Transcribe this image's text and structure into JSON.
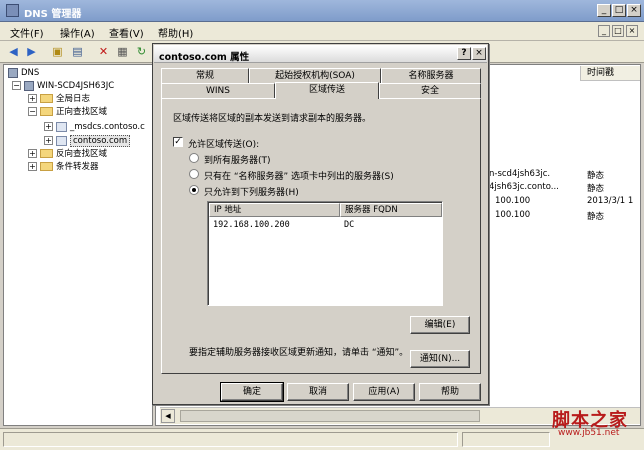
{
  "main_window": {
    "title": "DNS 管理器",
    "menu": [
      "文件(F)",
      "操作(A)",
      "查看(V)",
      "帮助(H)"
    ]
  },
  "tree": {
    "root": "DNS",
    "server": "WIN-SCD4JSH63JC",
    "global_logs": "全局日志",
    "forward_zones": "正向查找区域",
    "msdcs_zone": "_msdcs.contoso.c",
    "contoso_zone": "contoso.com",
    "reverse_zones": "反向查找区域",
    "conditional_forwarders": "条件转发器"
  },
  "right_pane": {
    "timestamp_header": "时间戳",
    "rows": [
      {
        "data": "n-scd4jsh63jc.",
        "timestamp": "静态"
      },
      {
        "data": "4jsh63jc.conto...",
        "timestamp": "静态"
      },
      {
        "data": "100.100",
        "timestamp": "2013/3/1 1"
      },
      {
        "data": "100.100",
        "timestamp": "静态"
      }
    ]
  },
  "dialog": {
    "title": "contoso.com 属性",
    "tabs_back": [
      "常规",
      "起始授权机构(SOA)",
      "名称服务器"
    ],
    "tabs_front": [
      "WINS",
      "区域传送",
      "安全"
    ],
    "active_tab": "区域传送",
    "description": "区域传送将区域的副本发送到请求副本的服务器。",
    "allow_transfer_label": "允许区域传送(O):",
    "allow_transfer_checked": true,
    "radio_all": "到所有服务器(T)",
    "radio_ns": "只有在 “名称服务器” 选项卡中列出的服务器(S)",
    "radio_list": "只允许到下列服务器(H)",
    "selected_radio": "radio_list",
    "list": {
      "columns": [
        "IP 地址",
        "服务器 FQDN"
      ],
      "rows": [
        {
          "ip": "192.168.100.200",
          "fqdn": "DC"
        }
      ]
    },
    "edit_button": "编辑(E)",
    "notify_text": "要指定辅助服务器接收区域更新通知，请单击 “通知”。",
    "notify_button": "通知(N)...",
    "ok": "确定",
    "cancel": "取消",
    "apply": "应用(A)",
    "help": "帮助"
  },
  "watermark": {
    "text": "脚本之家",
    "url": "www.jb51.net"
  }
}
